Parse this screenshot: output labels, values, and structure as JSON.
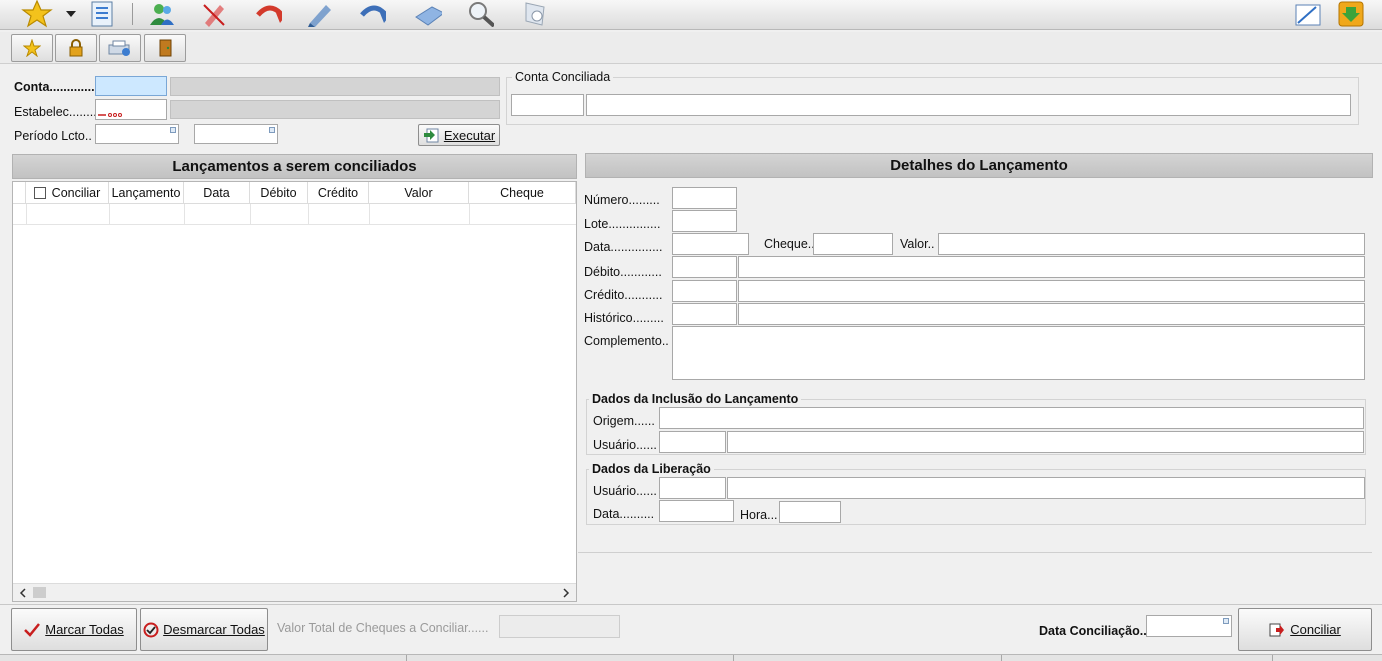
{
  "toolbar": {
    "icons": [
      "star-icon",
      "dropdown-arrow-icon",
      "document-list-icon",
      "users-icon",
      "cancel-edit-icon",
      "undo-icon",
      "edit-icon",
      "redo-icon",
      "eraser-icon",
      "search-icon",
      "shield-icon",
      "window-resize-icon",
      "download-icon"
    ]
  },
  "bar2": {
    "icons": [
      "favorite-icon",
      "lock-icon",
      "printer-settings-icon",
      "exit-door-icon"
    ]
  },
  "filters": {
    "conta_label": "Conta.............",
    "estabelec_label": "Estabelec........",
    "periodo_label": "Período Lcto..",
    "executar_label": "Executar"
  },
  "conta_conciliada": {
    "title": "Conta Conciliada"
  },
  "left_panel": {
    "title": "Lançamentos a serem conciliados",
    "columns": [
      "Conciliar",
      "Lançamento",
      "Data",
      "Débito",
      "Crédito",
      "Valor",
      "Cheque"
    ]
  },
  "right_panel": {
    "title": "Detalhes do Lançamento",
    "numero": "Número.........",
    "lote": "Lote...............",
    "data": "Data...............",
    "cheque": "Cheque..",
    "valor": "Valor..",
    "debito": "Débito............",
    "credito": "Crédito...........",
    "historico": "Histórico.........",
    "complemento": "Complemento..",
    "inclusao_title": "Dados da Inclusão do Lançamento",
    "origem": "Origem......",
    "usuario": "Usuário......",
    "liberacao_title": "Dados da Liberação",
    "lib_usuario": "Usuário......",
    "lib_data": "Data..........",
    "lib_hora": "Hora..."
  },
  "bottom": {
    "marcar": "Marcar Todas",
    "desmarcar": "Desmarcar Todas",
    "valor_total_label": "Valor Total de Cheques a Conciliar......",
    "data_conciliacao_label": "Data Conciliação..",
    "conciliar": "Conciliar"
  },
  "colors": {
    "accent_blue": "#2f6fc4",
    "check_red": "#c81e1e",
    "focus_field": "#cde8ff",
    "panel_header": "#c8c8c8"
  }
}
